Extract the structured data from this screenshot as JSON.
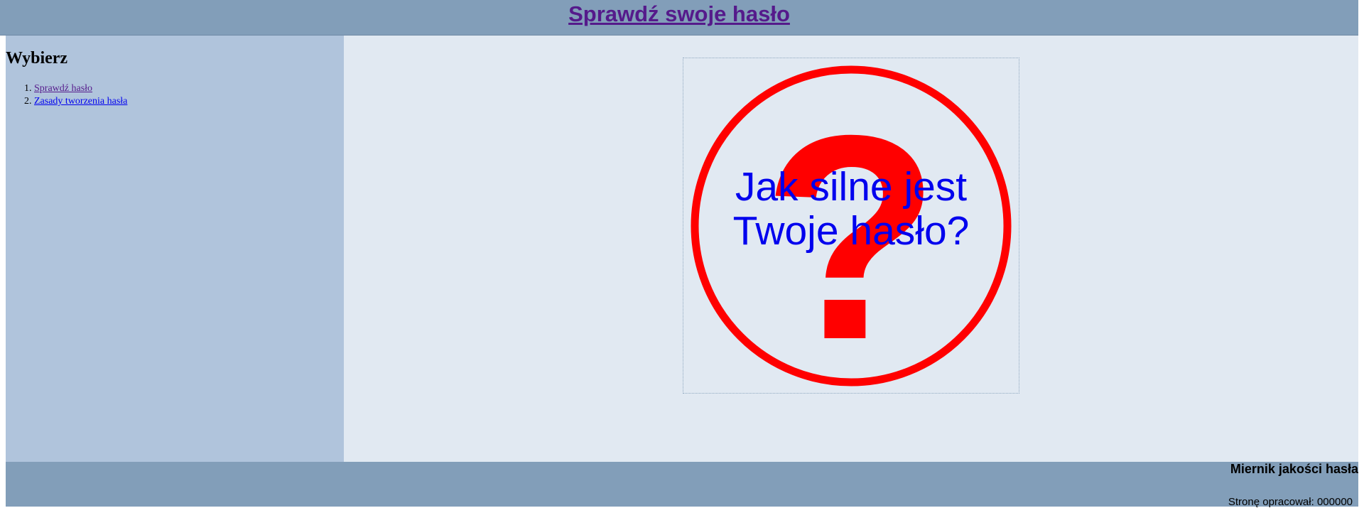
{
  "header": {
    "title": "Sprawdź swoje hasło"
  },
  "sidebar": {
    "heading": "Wybierz",
    "items": [
      {
        "label": "Sprawdź hasło"
      },
      {
        "label": "Zasady tworzenia hasła"
      }
    ]
  },
  "hero": {
    "line1": "Jak silne jest",
    "line2": "Twoje hasło?",
    "symbol": "?"
  },
  "footer": {
    "title": "Miernik jakości hasła",
    "author": "Stronę opracował: 000000"
  },
  "colors": {
    "header_bg": "#829eb9",
    "sidebar_bg": "#b0c4dc",
    "main_bg": "#e1e9f2",
    "hero_red": "#ff0000",
    "hero_blue": "#0000ee"
  }
}
